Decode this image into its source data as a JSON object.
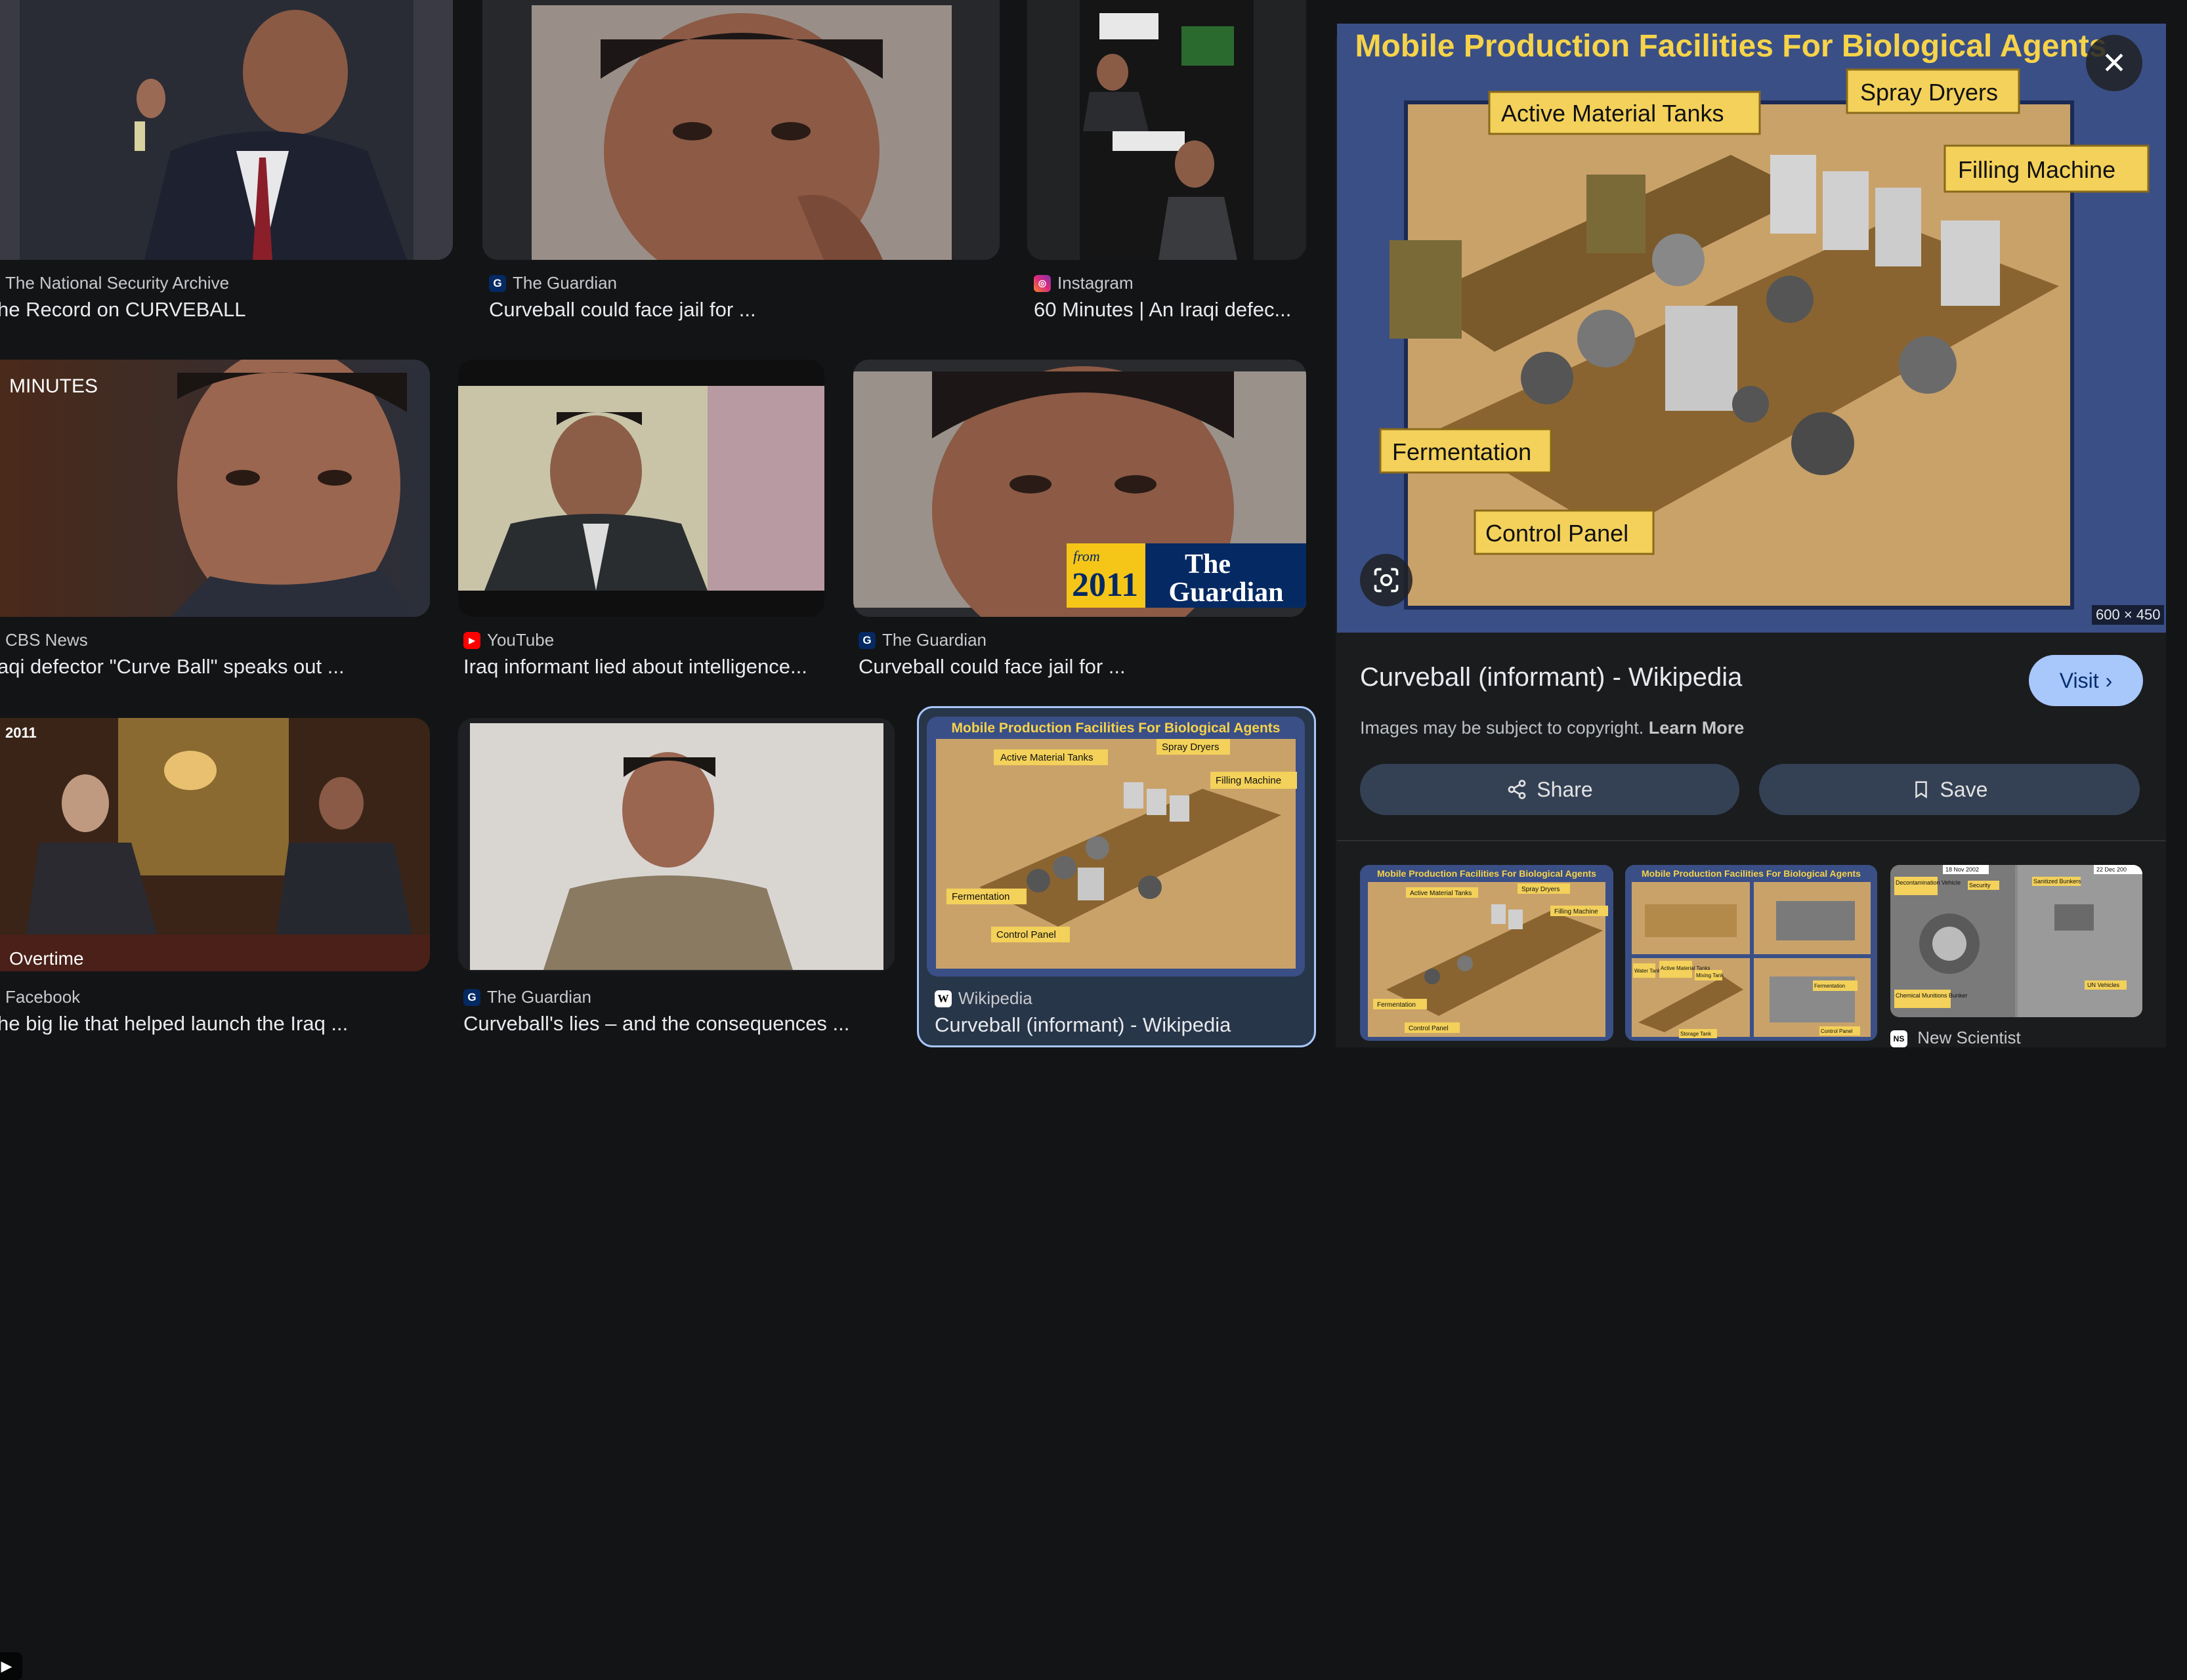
{
  "results": [
    {
      "source": "The National Security Archive",
      "title": "he Record on CURVEBALL",
      "favicon": "none"
    },
    {
      "source": "The Guardian",
      "title": "Curveball could face jail for ...",
      "favicon": "guardian-g"
    },
    {
      "source": "Instagram",
      "title": "60 Minutes | An Iraqi defec...",
      "favicon": "instagram"
    },
    {
      "source": "CBS News",
      "title": "aqi defector \"Curve Ball\" speaks out ...",
      "favicon": "none",
      "overlay_text": "MINUTES"
    },
    {
      "source": "YouTube",
      "title": "Iraq informant lied about intelligence...",
      "favicon": "youtube",
      "video": true
    },
    {
      "source": "The Guardian",
      "title": "Curveball could face jail for ...",
      "favicon": "guardian-g",
      "overlay": {
        "from": "from",
        "year": "2011",
        "brand_line1": "The",
        "brand_line2": "Guardian"
      }
    },
    {
      "source": "Facebook",
      "title": "he big lie that helped launch the Iraq ...",
      "favicon": "none",
      "overlay_year": "2011",
      "overlay_show": "Overtime",
      "video": true
    },
    {
      "source": "The Guardian",
      "title": "Curveball's lies – and the consequences ...",
      "favicon": "guardian-g"
    },
    {
      "source": "Wikipedia",
      "title": "Curveball (informant) - Wikipedia",
      "favicon": "wikipedia-w",
      "selected": true
    }
  ],
  "diagram": {
    "heading": "Mobile Production Facilities For Biological Agents",
    "labels": [
      "Active Material Tanks",
      "Spray Dryers",
      "Filling Machine",
      "Fermentation",
      "Control Panel"
    ]
  },
  "panel": {
    "title": "Curveball (informant) - Wikipedia",
    "visit_label": "Visit",
    "copyright": "Images may be subject to copyright.",
    "learn_more": "Learn More",
    "share_label": "Share",
    "save_label": "Save",
    "dimensions": "600 × 450",
    "related_source": "New Scientist",
    "related2_labels": [
      "Water Tank",
      "Active Material Tanks",
      "Mixing Tank",
      "Fermentation",
      "Storage Tank",
      "Control Panel"
    ],
    "related3_labels": [
      "18 Nov 2002",
      "22 Dec 200",
      "Decontamination Vehicle",
      "Security",
      "Sanitized Bunkers",
      "Chemical Munitions Bunker",
      "UN Vehicles"
    ]
  },
  "colors": {
    "background": "#131416",
    "accent": "#a8c7fa",
    "pill": "#344154",
    "diagram_board": "#c9a26a",
    "diagram_frame": "#3a4f86",
    "label_fill": "#f3d15a"
  },
  "icons": [
    "close-icon",
    "lens-icon",
    "share-icon",
    "bookmark-icon",
    "chevron-right-icon",
    "play-icon"
  ]
}
